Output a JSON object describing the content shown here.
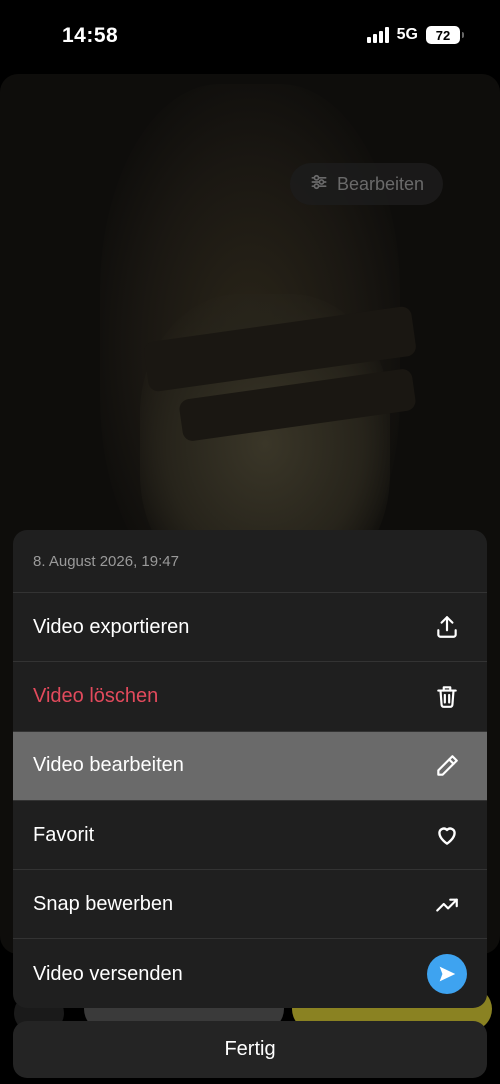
{
  "status_bar": {
    "time": "14:58",
    "network": "5G",
    "battery": "72"
  },
  "video": {
    "edit_button_label": "Bearbeiten"
  },
  "sheet": {
    "date": "8. August 2026, 19:47",
    "items": [
      {
        "label": "Video exportieren",
        "icon": "export-icon"
      },
      {
        "label": "Video löschen",
        "icon": "trash-icon",
        "color": "#e24a5c"
      },
      {
        "label": "Video bearbeiten",
        "icon": "pencil-icon",
        "highlighted": true
      },
      {
        "label": "Favorit",
        "icon": "heart-icon"
      },
      {
        "label": "Snap bewerben",
        "icon": "trending-up-icon"
      },
      {
        "label": "Video versenden",
        "icon": "send-icon",
        "color": "#3ea3f0"
      }
    ]
  },
  "done_label": "Fertig"
}
